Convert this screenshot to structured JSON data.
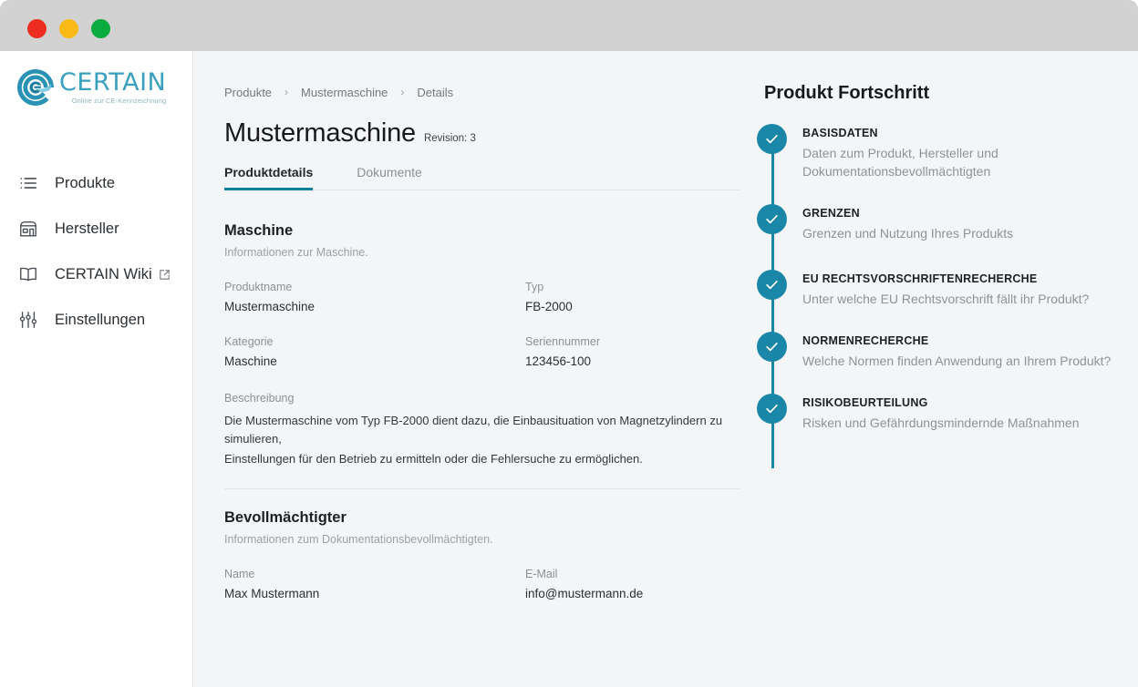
{
  "window": {
    "traffic_lights": [
      {
        "name": "close",
        "color": "#ed2d20"
      },
      {
        "name": "minimize",
        "color": "#f9ba15"
      },
      {
        "name": "maximize",
        "color": "#0cab3f"
      }
    ]
  },
  "brand": {
    "word": "CERTAIN",
    "tagline": "Online zur CE-Kennzeichnung",
    "color": "#3aa0bf"
  },
  "sidebar": {
    "items": [
      {
        "label": "Produkte",
        "icon": "list-icon",
        "external": false
      },
      {
        "label": "Hersteller",
        "icon": "storefront-icon",
        "external": false
      },
      {
        "label": "CERTAIN Wiki",
        "icon": "book-icon",
        "external": true
      },
      {
        "label": "Einstellungen",
        "icon": "sliders-icon",
        "external": false
      }
    ]
  },
  "breadcrumb": [
    {
      "label": "Produkte"
    },
    {
      "label": "Mustermaschine"
    },
    {
      "label": "Details"
    }
  ],
  "breadcrumb_separator": "›",
  "header": {
    "title": "Mustermaschine",
    "revision": "Revision: 3"
  },
  "tabs": [
    {
      "label": "Produktdetails",
      "active": true
    },
    {
      "label": "Dokumente",
      "active": false
    }
  ],
  "accent_color": "#0f7f9e",
  "machine_section": {
    "title": "Maschine",
    "subtitle": "Informationen zur Maschine.",
    "fields": [
      {
        "label": "Produktname",
        "value": "Mustermaschine"
      },
      {
        "label": "Typ",
        "value": "FB-2000"
      },
      {
        "label": "Kategorie",
        "value": "Maschine"
      },
      {
        "label": "Seriennummer",
        "value": "123456-100"
      }
    ],
    "description": {
      "label": "Beschreibung",
      "line1": "Die Mustermaschine vom Typ FB-2000 dient dazu, die Einbausituation von Magnetzylindern zu simulieren,",
      "line2": "Einstellungen für den Betrieb zu ermitteln oder die Fehlersuche zu ermöglichen."
    }
  },
  "bevollmaechtigter_section": {
    "title": "Bevollmächtigter",
    "subtitle": "Informationen zum Dokumentationsbevollmächtigten.",
    "fields": [
      {
        "label": "Name",
        "value": "Max Mustermann"
      },
      {
        "label": "E-Mail",
        "value": "info@mustermann.de"
      }
    ]
  },
  "progress": {
    "title": "Produkt Fortschritt",
    "step_color": "#1b87a8",
    "steps": [
      {
        "name": "BASISDATEN",
        "desc": "Daten zum Produkt, Hersteller und Dokumentationsbevollmächtigten",
        "status": "complete"
      },
      {
        "name": "GRENZEN",
        "desc": "Grenzen und Nutzung Ihres Produkts",
        "status": "complete"
      },
      {
        "name": "EU RECHTSVORSCHRIFTENRECHERCHE",
        "desc": "Unter welche EU Rechtsvorschrift fällt ihr Produkt?",
        "status": "complete"
      },
      {
        "name": "NORMENRECHERCHE",
        "desc": "Welche Normen finden Anwendung an Ihrem Produkt?",
        "status": "complete"
      },
      {
        "name": "RISIKOBEURTEILUNG",
        "desc": "Risken und Gefährdungsmindernde Maßnahmen",
        "status": "complete"
      }
    ]
  }
}
